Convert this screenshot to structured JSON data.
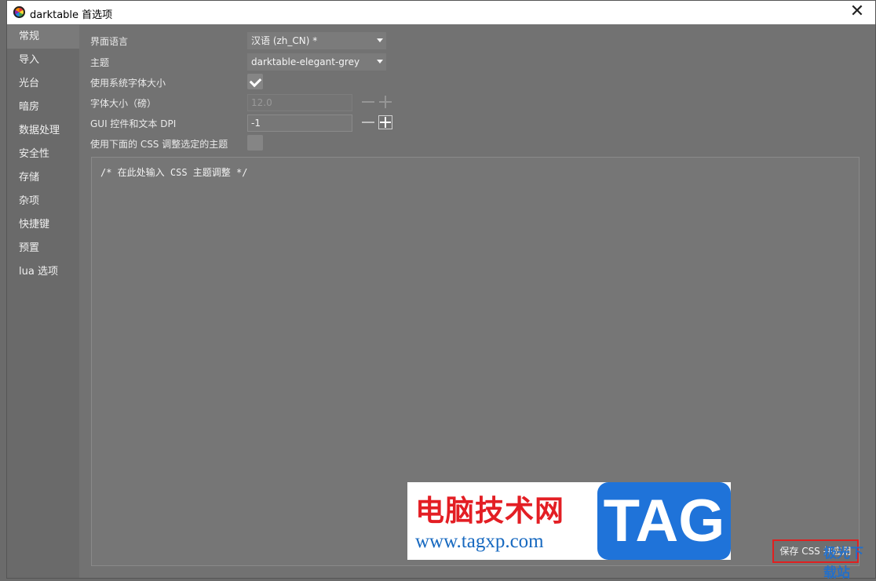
{
  "window": {
    "title": "darktable 首选项",
    "close_glyph": "✕"
  },
  "sidebar": {
    "items": [
      {
        "label": "常规"
      },
      {
        "label": "导入"
      },
      {
        "label": "光台"
      },
      {
        "label": "暗房"
      },
      {
        "label": "数据处理"
      },
      {
        "label": "安全性"
      },
      {
        "label": "存储"
      },
      {
        "label": "杂项"
      },
      {
        "label": "快捷键"
      },
      {
        "label": "预置"
      },
      {
        "label": "lua 选项"
      }
    ],
    "active_index": 0
  },
  "settings": {
    "language": {
      "label": "界面语言",
      "value": "汉语 (zh_CN) *"
    },
    "theme": {
      "label": "主题",
      "value": "darktable-elegant-grey"
    },
    "system_font": {
      "label": "使用系统字体大小",
      "checked": true
    },
    "font_size": {
      "label": "字体大小（磅）",
      "value": "12.0",
      "disabled": true
    },
    "dpi": {
      "label": "GUI 控件和文本 DPI",
      "value": "-1"
    },
    "css_tweak": {
      "label": "使用下面的 CSS 调整选定的主题",
      "checked": false
    }
  },
  "css_editor": {
    "text": "/* 在此处输入 CSS 主题调整 */"
  },
  "save_button": {
    "label": "保存 CSS 并应用"
  },
  "watermark": {
    "cn": "电脑技术网",
    "url": "www.tagxp.com",
    "tag": "TAG",
    "corner": "极光下载站"
  },
  "colors": {
    "background": "#727272",
    "sidebar": "#6a6a6a",
    "highlight_border": "#e02020",
    "watermark_blue": "#1f73d9",
    "watermark_red": "#e31e24"
  }
}
